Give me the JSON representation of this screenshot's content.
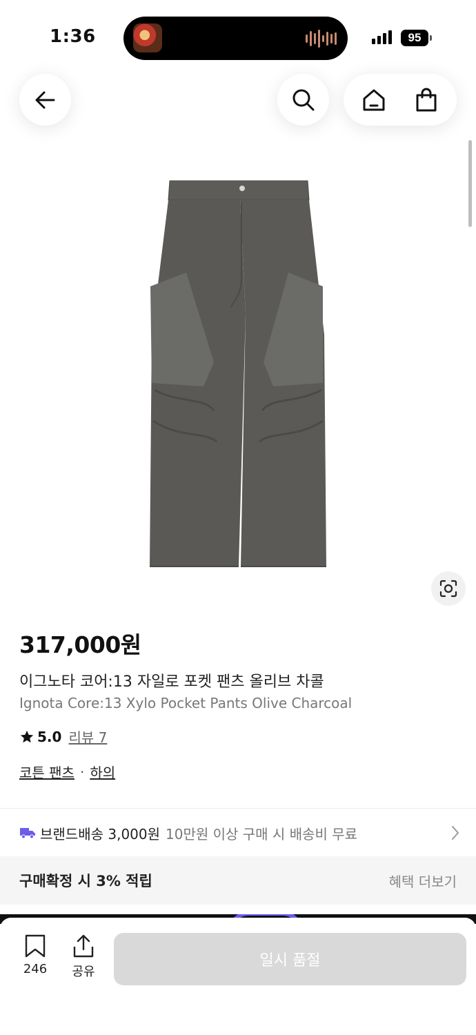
{
  "status_bar": {
    "time": "1:36",
    "battery": "95"
  },
  "product": {
    "price": "317,000원",
    "name_ko": "이그노타 코어:13 자일로 포켓 팬츠 올리브 차콜",
    "name_en": "Ignota Core:13 Xylo Pocket Pants Olive Charcoal",
    "rating": "5.0",
    "review_label": "리뷰 7",
    "category": "코튼 팬츠",
    "category_separator": "·",
    "category_parent": "하의",
    "image_icon": "pants-product-image",
    "image_color": "#5d5c59"
  },
  "delivery": {
    "label": "브랜드배송 3,000원",
    "sub": "10만원 이상 구매 시 배송비 무료",
    "icon": "truck-icon",
    "icon_color": "#6c5ce7"
  },
  "benefit": {
    "title": "구매확정 시 3% 적립",
    "more": "혜택 더보기"
  },
  "bottom_bar": {
    "bookmark_count": "246",
    "share_label": "공유",
    "soldout_label": "일시 품절"
  }
}
